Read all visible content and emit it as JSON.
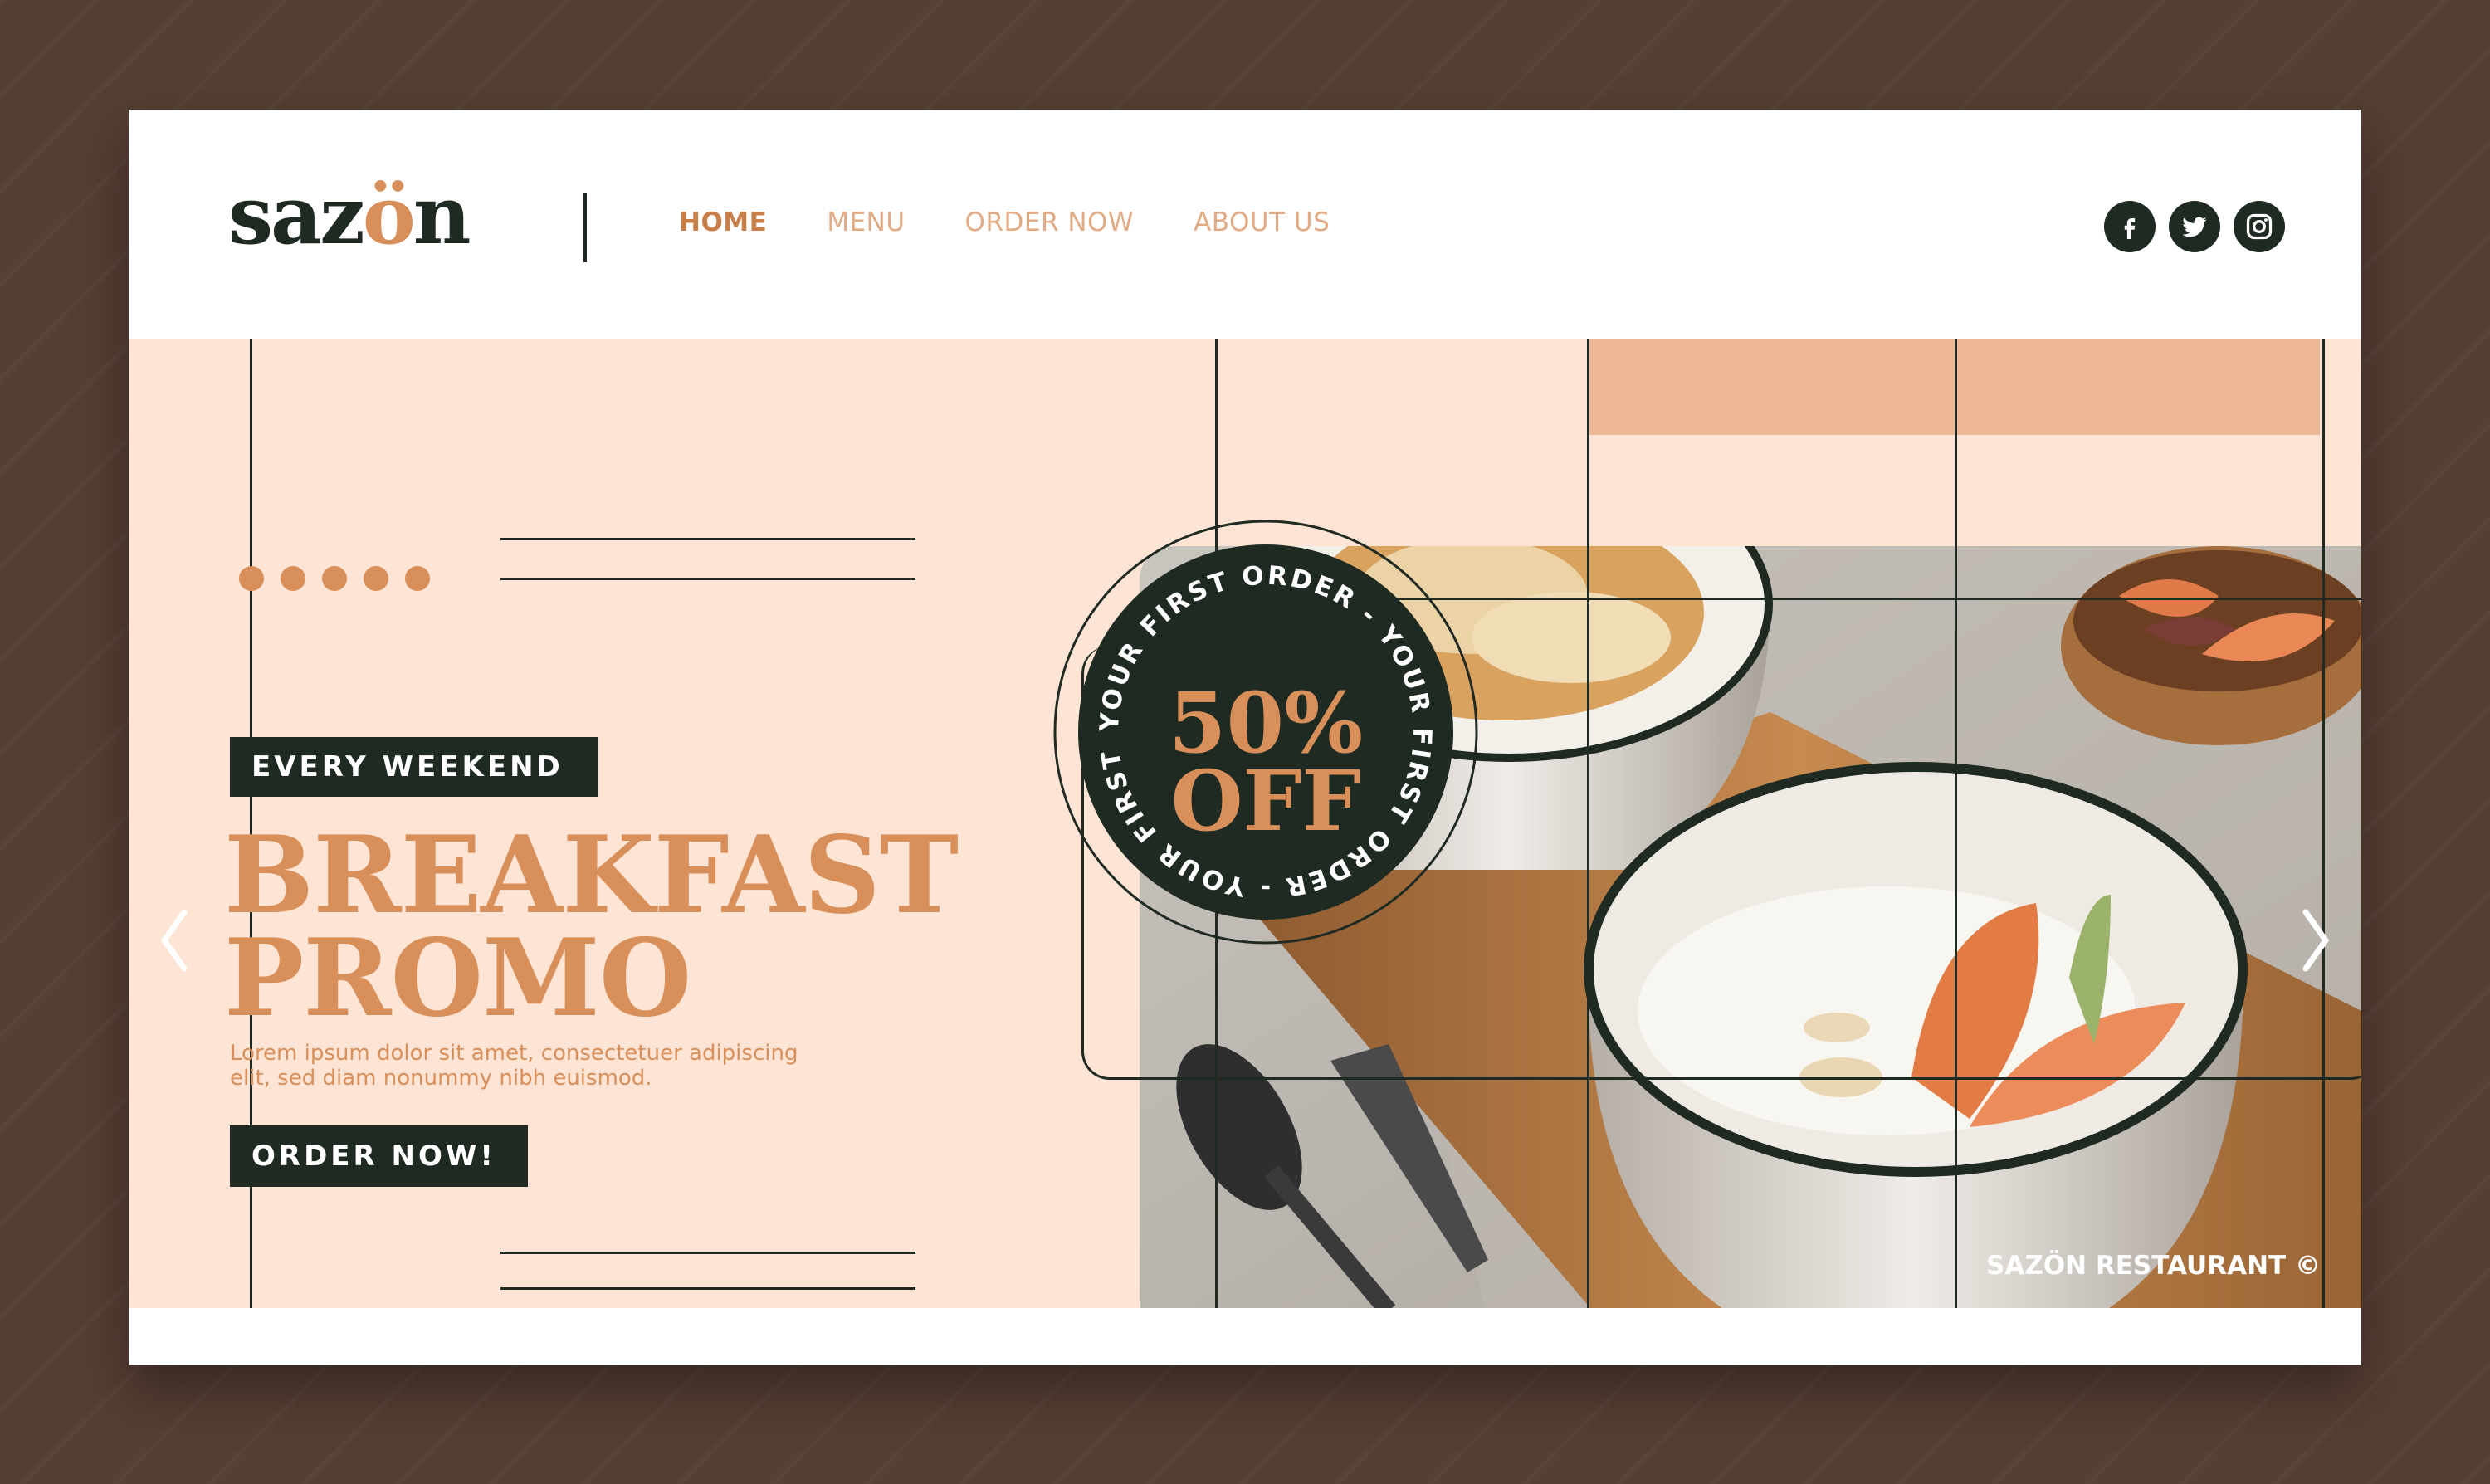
{
  "brand": {
    "logo_prefix": "saz",
    "logo_accent": "ö",
    "logo_suffix": "n"
  },
  "nav": {
    "items": [
      {
        "label": "HOME",
        "active": true
      },
      {
        "label": "MENU",
        "active": false
      },
      {
        "label": "ORDER NOW",
        "active": false
      },
      {
        "label": "ABOUT US",
        "active": false
      }
    ]
  },
  "social": {
    "icons": [
      "facebook-icon",
      "twitter-icon",
      "instagram-icon"
    ]
  },
  "hero": {
    "badge": "EVERY WEEKEND",
    "headline_line1": "BREAKFAST",
    "headline_line2": "PROMO",
    "description_line1": "Lorem ipsum dolor sit amet, consectetuer adipiscing",
    "description_line2": "elit, sed diam nonummy nibh euismod.",
    "cta": "ORDER NOW!"
  },
  "promo_seal": {
    "ring_text": "YOUR FIRST ORDER - YOUR FIRST ORDER - YOUR FIRST ORDER - ",
    "amount": "50%",
    "label": "OFF"
  },
  "footer": {
    "copyright": "SAZÖN RESTAURANT ©"
  },
  "colors": {
    "dark_green": "#1f2a22",
    "accent": "#d98f5a",
    "hero_bg": "#fde4d4",
    "peach_block": "#edb795",
    "backdrop": "#553e33"
  }
}
